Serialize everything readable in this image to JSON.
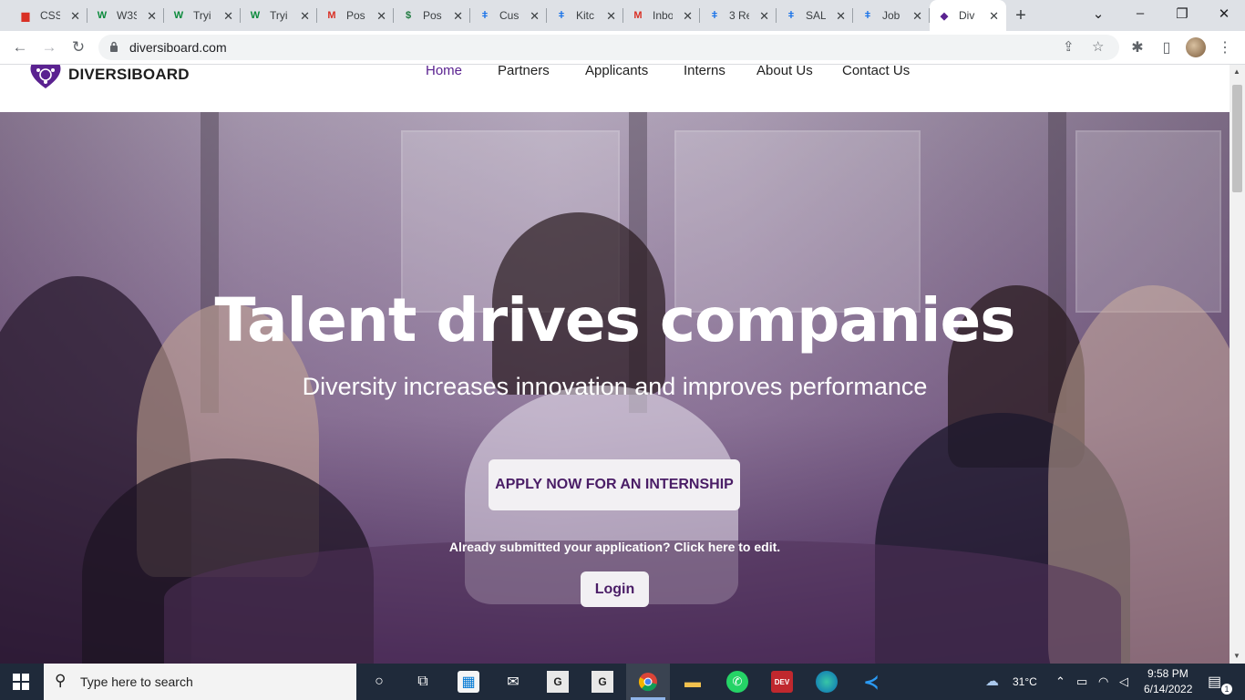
{
  "browser": {
    "tabs": [
      {
        "title": "CSS",
        "favicon": "rail-icon",
        "color": "#d93025"
      },
      {
        "title": "W3S",
        "favicon": "w3-icon",
        "color": "#0a8a3b"
      },
      {
        "title": "Tryi",
        "favicon": "w3-icon",
        "color": "#0a8a3b"
      },
      {
        "title": "Tryi",
        "favicon": "w3-icon",
        "color": "#0a8a3b"
      },
      {
        "title": "Pos",
        "favicon": "gmail-icon",
        "color": "#d93025"
      },
      {
        "title": "Pos",
        "favicon": "dollar-icon",
        "color": "#1e7a3e"
      },
      {
        "title": "Cus",
        "favicon": "pin-icon",
        "color": "#1a73e8"
      },
      {
        "title": "Kitc",
        "favicon": "pin-icon",
        "color": "#1a73e8"
      },
      {
        "title": "Inbo",
        "favicon": "gmail-icon",
        "color": "#d93025"
      },
      {
        "title": "3 Re",
        "favicon": "pin-icon",
        "color": "#1a73e8"
      },
      {
        "title": "SAL",
        "favicon": "pin-icon",
        "color": "#1a73e8"
      },
      {
        "title": "Job",
        "favicon": "pin-icon",
        "color": "#1a73e8"
      },
      {
        "title": "Div",
        "favicon": "diversiboard-icon",
        "color": "#5a2290",
        "active": true
      }
    ],
    "url": "diversiboard.com"
  },
  "site": {
    "logo_text": "DIVERSIBOARD",
    "nav": [
      "Home",
      "Partners",
      "Applicants",
      "Interns",
      "About Us",
      "Contact Us"
    ],
    "active_nav": "Home",
    "brand_color": "#5a2290"
  },
  "hero": {
    "title": "Talent drives companies",
    "subtitle": "Diversity increases innovation and improves performance",
    "apply_label": "APPLY NOW FOR AN INTERNSHIP",
    "edit_note": "Already submitted your application? Click here to edit.",
    "login_label": "Login"
  },
  "taskbar": {
    "search_placeholder": "Type here to search",
    "temperature": "31°C",
    "time": "9:58 PM",
    "date": "6/14/2022",
    "notifications": "1"
  }
}
